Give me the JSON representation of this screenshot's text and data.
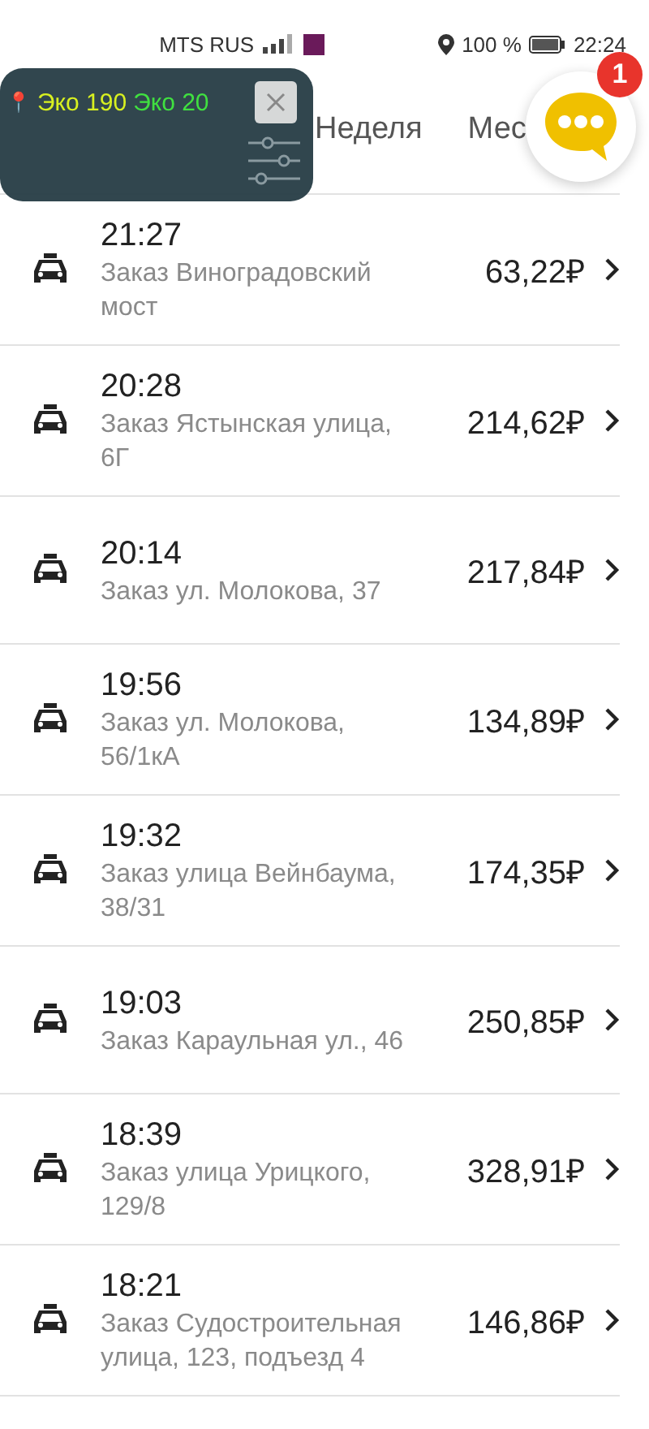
{
  "status_bar": {
    "carrier": "MTS RUS",
    "battery": "100 %",
    "time": "22:24"
  },
  "overlay": {
    "pin": "📍",
    "eco_a": "Эко 190",
    "eco_b": "Эко 20"
  },
  "tabs": [
    {
      "label": "Неделя",
      "selected": false
    },
    {
      "label": "Мес",
      "selected": false
    }
  ],
  "chat": {
    "badge": "1"
  },
  "orders": [
    {
      "time": "21:27",
      "address": "Заказ Виноградовский мост",
      "price": "63,22₽"
    },
    {
      "time": "20:28",
      "address": "Заказ Ястынская улица, 6Г",
      "price": "214,62₽"
    },
    {
      "time": "20:14",
      "address": "Заказ ул. Молокова, 37",
      "price": "217,84₽"
    },
    {
      "time": "19:56",
      "address": "Заказ ул. Молокова, 56/1кА",
      "price": "134,89₽"
    },
    {
      "time": "19:32",
      "address": "Заказ улица Вейнбаума, 38/31",
      "price": "174,35₽"
    },
    {
      "time": "19:03",
      "address": "Заказ Караульная ул., 46",
      "price": "250,85₽"
    },
    {
      "time": "18:39",
      "address": "Заказ улица Урицкого, 129/8",
      "price": "328,91₽"
    },
    {
      "time": "18:21",
      "address": "Заказ Судостроительная улица, 123, подъезд 4",
      "price": "146,86₽"
    }
  ]
}
